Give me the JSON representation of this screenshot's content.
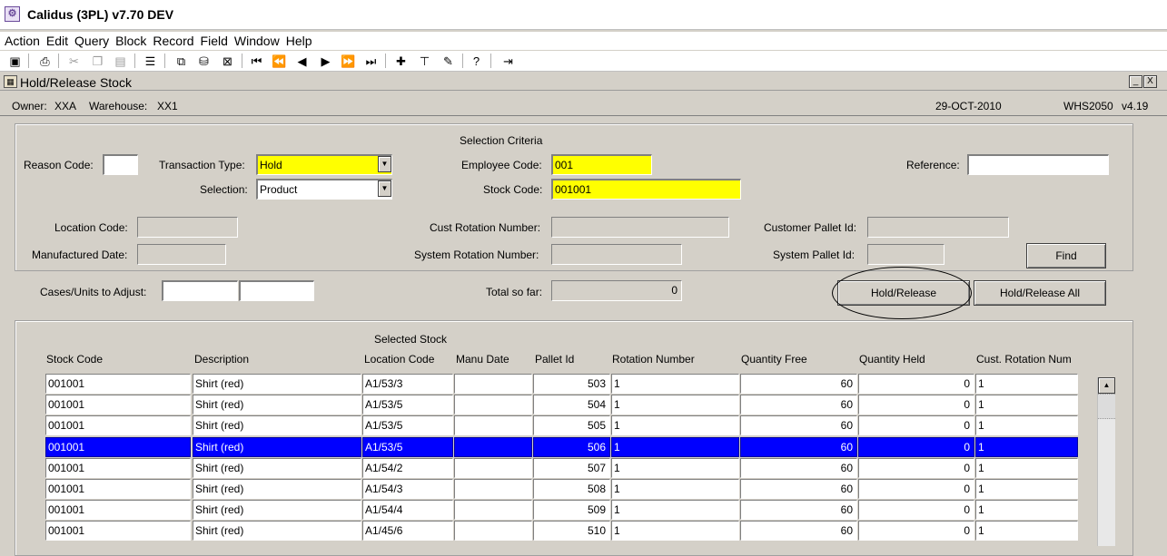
{
  "app": {
    "title": "Calidus (3PL) v7.70 DEV",
    "icon_name": "app-crest-icon"
  },
  "menu": [
    "Action",
    "Edit",
    "Query",
    "Block",
    "Record",
    "Field",
    "Window",
    "Help"
  ],
  "toolbar_icons": [
    "save-icon",
    "print-icon",
    "cut-icon",
    "copy-icon",
    "paste-icon",
    "list-icon",
    "enter-query-icon",
    "execute-query-icon",
    "cancel-query-icon",
    "first-record-icon",
    "previous-block-icon",
    "previous-record-icon",
    "next-record-icon",
    "next-block-icon",
    "last-record-icon",
    "insert-record-icon",
    "delete-record-icon",
    "clear-record-icon",
    "help-icon",
    "exit-icon"
  ],
  "window": {
    "title": "Hold/Release Stock",
    "minimize": "_",
    "close": "X"
  },
  "info": {
    "owner_label": "Owner:",
    "owner": "XXA",
    "warehouse_label": "Warehouse:",
    "warehouse": "XX1",
    "date": "29-OCT-2010",
    "program": "WHS2050",
    "version": "v4.19"
  },
  "criteria": {
    "title": "Selection Criteria",
    "reason_code_label": "Reason Code:",
    "reason_code": "",
    "transaction_type_label": "Transaction Type:",
    "transaction_type": "Hold",
    "selection_label": "Selection:",
    "selection": "Product",
    "employee_code_label": "Employee Code:",
    "employee_code": "001",
    "stock_code_label": "Stock Code:",
    "stock_code": "001001",
    "reference_label": "Reference:",
    "reference": "",
    "location_code_label": "Location Code:",
    "location_code": "",
    "manufactured_date_label": "Manufactured Date:",
    "manufactured_date": "",
    "cust_rotation_label": "Cust Rotation Number:",
    "cust_rotation": "",
    "system_rotation_label": "System Rotation Number:",
    "system_rotation": "",
    "customer_pallet_label": "Customer Pallet Id:",
    "customer_pallet": "",
    "system_pallet_label": "System Pallet Id:",
    "system_pallet": "",
    "find_label": "Find"
  },
  "adjust": {
    "cases_label": "Cases/Units to Adjust:",
    "cases": "",
    "units": "",
    "total_label": "Total so far:",
    "total": "0",
    "hold_release_label": "Hold/Release",
    "hold_release_all_label": "Hold/Release All"
  },
  "table": {
    "title": "Selected Stock",
    "headers": [
      "Stock Code",
      "Description",
      "Location Code",
      "Manu Date",
      "Pallet Id",
      "Rotation Number",
      "Quantity Free",
      "Quantity Held",
      "Cust. Rotation Num"
    ],
    "rows": [
      [
        "001001",
        "Shirt (red)",
        "A1/53/3",
        "",
        "503",
        "1",
        "60",
        "0",
        "1"
      ],
      [
        "001001",
        "Shirt (red)",
        "A1/53/5",
        "",
        "504",
        "1",
        "60",
        "0",
        "1"
      ],
      [
        "001001",
        "Shirt (red)",
        "A1/53/5",
        "",
        "505",
        "1",
        "60",
        "0",
        "1"
      ],
      [
        "001001",
        "Shirt (red)",
        "A1/53/5",
        "",
        "506",
        "1",
        "60",
        "0",
        "1"
      ],
      [
        "001001",
        "Shirt (red)",
        "A1/54/2",
        "",
        "507",
        "1",
        "60",
        "0",
        "1"
      ],
      [
        "001001",
        "Shirt (red)",
        "A1/54/3",
        "",
        "508",
        "1",
        "60",
        "0",
        "1"
      ],
      [
        "001001",
        "Shirt (red)",
        "A1/54/4",
        "",
        "509",
        "1",
        "60",
        "0",
        "1"
      ],
      [
        "001001",
        "Shirt (red)",
        "A1/45/6",
        "",
        "510",
        "1",
        "60",
        "0",
        "1"
      ]
    ],
    "selected_row": 3
  },
  "colors": {
    "highlight": "#0000ff",
    "mandatory": "#ffff00",
    "form_bg": "#d4d0c8"
  }
}
